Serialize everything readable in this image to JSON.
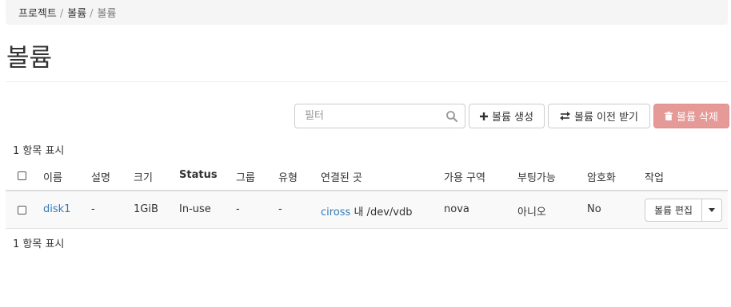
{
  "breadcrumb": {
    "items": [
      "프로젝트",
      "볼륨",
      "볼륨"
    ],
    "separator": "/"
  },
  "page": {
    "title": "볼륨"
  },
  "toolbar": {
    "filter_placeholder": "필터",
    "create_label": "볼륨 생성",
    "transfer_label": "볼륨 이전 받기",
    "delete_label": "볼륨 삭제",
    "delete_color": "#e59a98"
  },
  "table": {
    "count_text": "1 항목 표시",
    "columns": [
      "이름",
      "설명",
      "크기",
      "Status",
      "그룹",
      "유형",
      "연결된 곳",
      "가용 구역",
      "부팅가능",
      "암호화",
      "작업"
    ],
    "rows": [
      {
        "name": "disk1",
        "description": "-",
        "size": "1GiB",
        "status": "In-use",
        "group": "-",
        "type": "-",
        "attached_instance": "ciross",
        "attached_rest": "내 /dev/vdb",
        "zone": "nova",
        "bootable": "아니오",
        "encrypted": "No",
        "action_label": "볼륨 편집"
      }
    ]
  },
  "colors": {
    "link": "#337ab7",
    "breadcrumb_bg": "#f5f5f5"
  }
}
